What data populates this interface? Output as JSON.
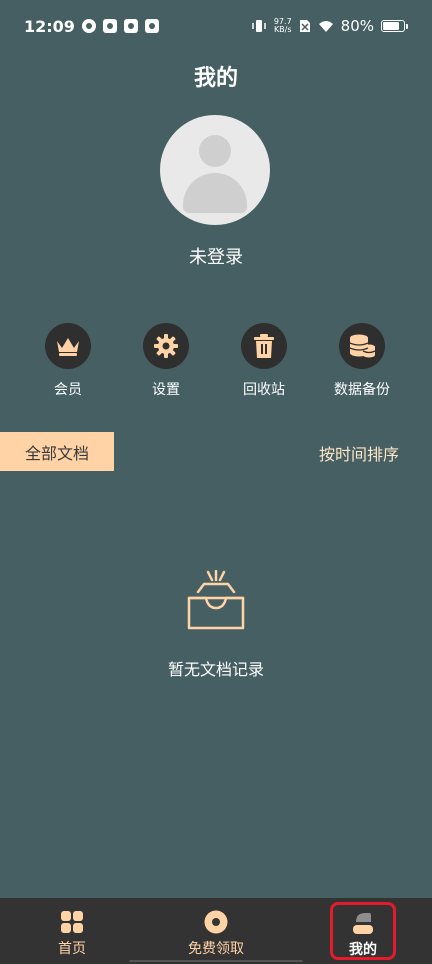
{
  "status_bar": {
    "time": "12:09",
    "net_speed_value": "97.7",
    "net_speed_unit": "KB/s",
    "battery": "80%"
  },
  "page": {
    "title": "我的",
    "login_status": "未登录"
  },
  "actions": [
    {
      "label": "会员",
      "icon": "crown-icon"
    },
    {
      "label": "设置",
      "icon": "gear-icon"
    },
    {
      "label": "回收站",
      "icon": "trash-icon"
    },
    {
      "label": "数据备份",
      "icon": "database-backup-icon"
    }
  ],
  "documents": {
    "tab_label": "全部文档",
    "sort_label": "按时间排序",
    "empty_text": "暂无文档记录"
  },
  "bottom_nav": {
    "items": [
      {
        "label": "首页",
        "icon": "grid-icon"
      },
      {
        "label": "免费领取",
        "icon": "circle-dot-icon"
      },
      {
        "label": "我的",
        "icon": "profile-icon",
        "active": true
      }
    ]
  },
  "colors": {
    "background": "#455f63",
    "accent": "#ffd3a6",
    "nav_background": "#333333",
    "highlight_border": "#e31b2b"
  }
}
